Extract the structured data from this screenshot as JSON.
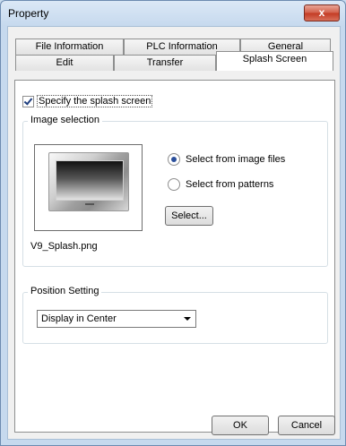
{
  "window": {
    "title": "Property",
    "close_label": "x"
  },
  "tabs": {
    "row1": [
      "File Information",
      "PLC Information",
      "General"
    ],
    "row2": [
      "Edit",
      "Transfer",
      "Splash Screen"
    ],
    "active": "Splash Screen"
  },
  "splash": {
    "checkbox_label": "Specify the splash screen",
    "checked": true
  },
  "image_selection": {
    "group_title": "Image selection",
    "filename": "V9_Splash.png",
    "radio_options": [
      "Select from image files",
      "Select from patterns"
    ],
    "selected_option": "Select from image files",
    "select_button": "Select..."
  },
  "position_setting": {
    "group_title": "Position Setting",
    "selected_value": "Display in Center"
  },
  "buttons": {
    "ok": "OK",
    "cancel": "Cancel"
  }
}
